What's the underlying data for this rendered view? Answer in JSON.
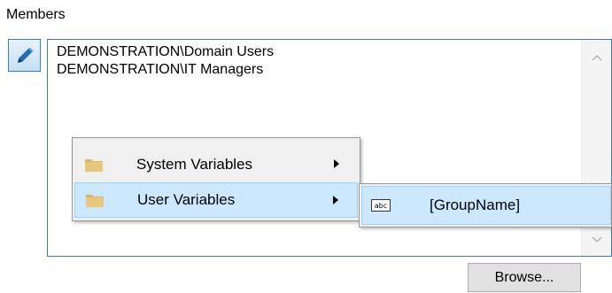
{
  "members_label": "Members",
  "members": [
    "DEMONSTRATION\\Domain Users",
    "DEMONSTRATION\\IT Managers"
  ],
  "context_menu": {
    "items": [
      {
        "label": "System Variables",
        "icon": "folder-icon",
        "submenu": true,
        "highlighted": false
      },
      {
        "label": "User Variables",
        "icon": "folder-icon",
        "submenu": true,
        "highlighted": true
      }
    ]
  },
  "submenu": {
    "items": [
      {
        "label": "[GroupName]",
        "icon_text": "abc",
        "highlighted": true
      }
    ]
  },
  "browse_button_label": "Browse...",
  "colors": {
    "accent_border": "#3c7fb1",
    "highlight_bg": "#cce8ff",
    "highlight_border": "#99d1ff",
    "menu_bg": "#f0f0f0",
    "folder_yellow": "#dcb567"
  }
}
